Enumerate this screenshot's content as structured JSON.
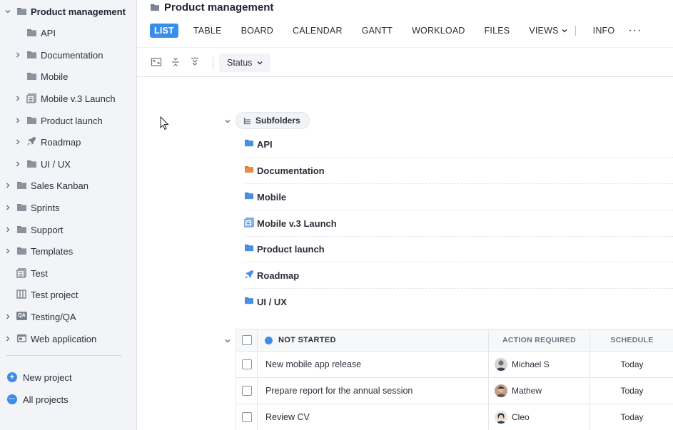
{
  "sidebar": {
    "items": [
      {
        "label": "Product management",
        "icon": "folder-icon",
        "expanded": true
      },
      {
        "label": "API",
        "icon": "folder-icon"
      },
      {
        "label": "Documentation",
        "icon": "folder-icon"
      },
      {
        "label": "Mobile",
        "icon": "folder-icon"
      },
      {
        "label": "Mobile v.3 Launch",
        "icon": "list-project-icon"
      },
      {
        "label": "Product launch",
        "icon": "folder-icon"
      },
      {
        "label": "Roadmap",
        "icon": "rocket-icon"
      },
      {
        "label": "UI / UX",
        "icon": "folder-icon"
      },
      {
        "label": "Sales Kanban",
        "icon": "folder-icon"
      },
      {
        "label": "Sprints",
        "icon": "folder-icon"
      },
      {
        "label": "Support",
        "icon": "folder-icon"
      },
      {
        "label": "Templates",
        "icon": "folder-icon"
      },
      {
        "label": "Test",
        "icon": "list-project-icon"
      },
      {
        "label": "Test project",
        "icon": "board-icon"
      },
      {
        "label": "Testing/QA",
        "icon": "qa-icon",
        "badge": "QA"
      },
      {
        "label": "Web application",
        "icon": "web-app-icon"
      }
    ],
    "new_project": "New project",
    "all_projects": "All projects"
  },
  "header": {
    "title": "Product management",
    "tabs": [
      "LIST",
      "TABLE",
      "BOARD",
      "CALENDAR",
      "GANTT",
      "WORKLOAD",
      "FILES",
      "VIEWS",
      "INFO"
    ],
    "active_tab": "LIST",
    "more": "···"
  },
  "toolbar": {
    "status_label": "Status"
  },
  "subfolders": {
    "label": "Subfolders",
    "items": [
      {
        "label": "API",
        "icon": "folder-icon",
        "color": "#4a90e2"
      },
      {
        "label": "Documentation",
        "icon": "folder-icon",
        "color": "#e8894a"
      },
      {
        "label": "Mobile",
        "icon": "folder-icon",
        "color": "#4a90e2"
      },
      {
        "label": "Mobile v.3 Launch",
        "icon": "list-project-icon",
        "color": "#4a90e2"
      },
      {
        "label": "Product launch",
        "icon": "folder-icon",
        "color": "#4a90e2"
      },
      {
        "label": "Roadmap",
        "icon": "rocket-icon",
        "color": "#4a90e2"
      },
      {
        "label": "UI / UX",
        "icon": "folder-icon",
        "color": "#4a90e2"
      }
    ]
  },
  "task_group": {
    "status": "NOT STARTED",
    "status_color": "#3b8ee8",
    "columns": {
      "action": "ACTION REQUIRED",
      "schedule": "SCHEDULE"
    },
    "rows": [
      {
        "name": "New mobile app release",
        "assignee": "Michael S",
        "schedule": "Today"
      },
      {
        "name": "Prepare report for the annual session",
        "assignee": "Mathew",
        "schedule": "Today"
      },
      {
        "name": "Review CV",
        "assignee": "Cleo",
        "schedule": "Today"
      }
    ]
  }
}
